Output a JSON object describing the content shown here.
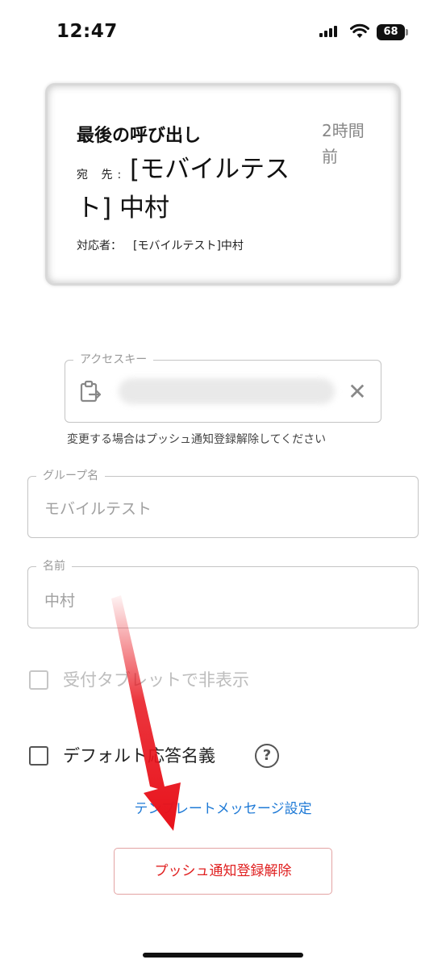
{
  "status_bar": {
    "time": "12:47",
    "battery": "68"
  },
  "call_card": {
    "title": "最後の呼び出し",
    "time_ago": "2時間前",
    "to_label": "宛 先:",
    "to_value": "[モバイルテスト] 中村",
    "handler_label": "対応者：",
    "handler_value": "[モバイルテスト]中村"
  },
  "access_key": {
    "label": "アクセスキー",
    "helper": "変更する場合はプッシュ通知登録解除してください",
    "clipboard_icon": "clipboard-paste-icon",
    "clear_icon": "close-icon"
  },
  "group": {
    "label": "グループ名",
    "value": "モバイルテスト"
  },
  "name": {
    "label": "名前",
    "value": "中村"
  },
  "checkboxes": {
    "hide_on_tablet": "受付タブレットで非表示",
    "default_responder": "デフォルト応答名義"
  },
  "help_icon": "?",
  "template_link": "テンプレートメッセージ設定",
  "unregister_button": "プッシュ通知登録解除",
  "colors": {
    "link": "#1f7ad6",
    "danger": "#e02020",
    "annotation_arrow": "#e8121b"
  }
}
